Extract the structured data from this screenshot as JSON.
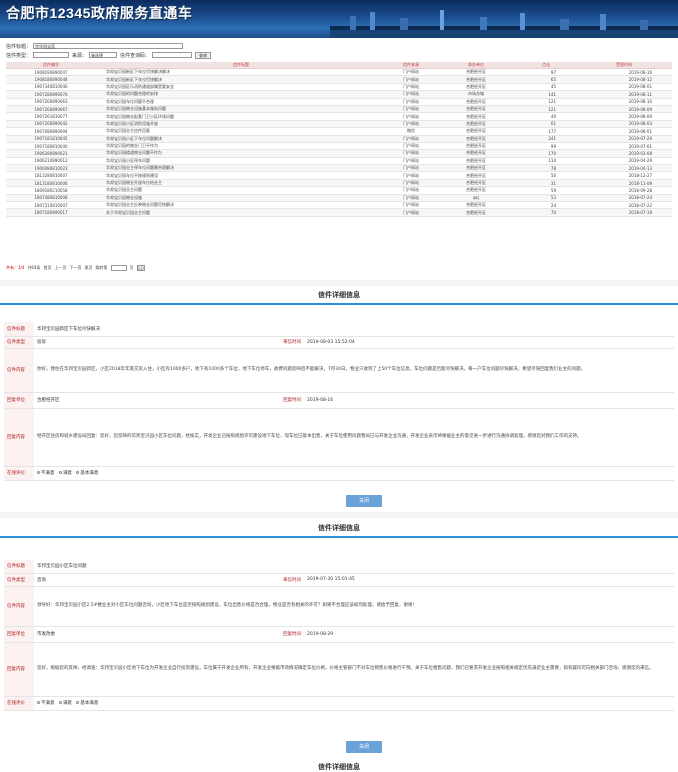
{
  "header": {
    "title": "合肥市12345政府服务直通车"
  },
  "search": {
    "title_label": "信件标题：",
    "title_value": "宗华园宝蓝",
    "type_label": "信件类型：",
    "from_label": "来源：",
    "from_value": "来选择",
    "code_label": "信件查询码：",
    "search_btn": "查询"
  },
  "table": {
    "headers": [
      "信件编号",
      "信件标题",
      "信件来源",
      "承办单位",
      "点击",
      "受理时间"
    ],
    "rows": [
      [
        "1908190890047",
        "华邦宝贝园新区下车位尽快解决解决",
        "门户网站",
        "合肥经开区",
        "97",
        "2019-08-16"
      ],
      [
        "1908180890048",
        "华邦宝贝园新区下车位尽快解决",
        "门户网站",
        "合肥经开区",
        "65",
        "2019-08-12"
      ],
      [
        "1907340810040",
        "华邦宝贝园区乐消防通道部属是要安全",
        "门户网站",
        "合肥经开区",
        "45",
        "2019-08-01"
      ],
      [
        "1907280890076",
        "华邦宝贝园的问题合理的安排",
        "门户网站",
        "市场东城",
        "141",
        "2019-08-11"
      ],
      [
        "1907260890063",
        "华邦宝贝园车位问题不合理",
        "门户网站",
        "合肥经开区",
        "121",
        "2019-08-10"
      ],
      [
        "1907260890067",
        "华邦宝贝园物业设施基本服务问题",
        "门户网站",
        "合肥经开区",
        "121",
        "2019-08-09"
      ],
      [
        "1907261810077",
        "华邦宝贝园物业配套门卫小区环境问题",
        "门户网站",
        "合肥经开区",
        "40",
        "2019-08-09"
      ],
      [
        "1907260890042",
        "华邦宝贝园小区消防设施开放",
        "门户网站",
        "合肥经开区",
        "61",
        "2019-08-03"
      ],
      [
        "1907080890094",
        "华邦宝贝园业主信件回复",
        "微信",
        "合肥经开区",
        "177",
        "2019-08-01"
      ],
      [
        "1907181810045",
        "华邦宝贝园小区下车位问题解决",
        "门户网站",
        "合肥经开区",
        "241",
        "2019-07-29"
      ],
      [
        "1907180810040",
        "华邦宝贝园的物业门卫不作为",
        "门户网站",
        "合肥经开区",
        "99",
        "2019-07-01"
      ],
      [
        "1906280890021",
        "华邦宝贝园楼道物业问题不作为",
        "门户网站",
        "合肥经开区",
        "170",
        "2019-03-08"
      ],
      [
        "1906210890012",
        "华邦宝贝园小区停车问题",
        "门户网站",
        "合肥经开区",
        "114",
        "2019-04-29"
      ],
      [
        "1906080810023",
        "华邦宝贝园业主停车位问题需合理解决",
        "门户网站",
        "合肥经开区",
        "78",
        "2019-04-13"
      ],
      [
        "1813280810007",
        "华邦宝贝园车位不按规则建设",
        "门户网站",
        "合肥经开区",
        "50",
        "2018-12-27"
      ],
      [
        "1813180810006",
        "华邦宝贝园物业开放车位给业主",
        "门户网站",
        "合肥经开区",
        "31",
        "2018-11-09"
      ],
      [
        "1809180210058",
        "华邦宝贝园业主问题",
        "门户网站",
        "合肥经开区",
        "59",
        "2018-09-28"
      ],
      [
        "1807480810008",
        "华邦宝贝园物业设施",
        "门户网站",
        "qkj",
        "53",
        "2018-07-24"
      ],
      [
        "1807310810007",
        "华邦宝贝园业主反映物业问题尽快解决",
        "门户网站",
        "合肥经开区",
        "24",
        "2018-07-22"
      ],
      [
        "1807180890017",
        "关于华邦宝贝园业主问题",
        "门户网站",
        "合肥经开区",
        "70",
        "2018-07-19"
      ]
    ]
  },
  "pager": {
    "text": "共有：1/4",
    "total": "共64条",
    "first": "首页",
    "prev": "上一页",
    "next": "下一页",
    "last": "尾页",
    "jump": "跳转第",
    "page": "页",
    "go": "GO"
  },
  "detail1": {
    "section_title": "信件详细信息",
    "subject_k": "信件标题",
    "subject_v": "华邦宝贝园新区下车位尽快解决",
    "type_k": "信件类型",
    "type_v": "投诉",
    "time_k": "来信时间",
    "time_v": "2019-08-03 15:52:04",
    "content_k": "信件内容",
    "content_v": "你好，我住在华邦宝贝园新区，小区2018年年底交房入住，小区有1000多户，地下有1000多个车位，地下车位停车，收费问题反映后不能解决，7月30日，物业只收到了上50个车位信息。车位问题是否能尽快解决，每一户车位问题尽快解决，希望尽快回复我们业主的问题。",
    "unit_k": "回复单位",
    "unit_v": "合肥经开区",
    "rtime_k": "回复时间",
    "rtime_v": "2019-08-16",
    "reply_k": "回复内容",
    "reply_v": "经开区住房和城乡建设局回复：您好，您反映的华邦宝贝园小区车位问题，经核实，开发企业已按照规划许可建设地下车位，现车位已基本出售，关于车位使用问题我局已与开发企业沟通，开发企业表示将根据业主的意见进一步进行沟通协调处理，感谢您对我们工作的支持。",
    "eval_k": "在线评价",
    "eval_opts": [
      "不满意",
      "满意",
      "基本满意"
    ],
    "close_btn": "关闭"
  },
  "detail2": {
    "section_title": "信件详细信息",
    "subject_k": "信件标题",
    "subject_v": "华邦宝贝园小区车位问题",
    "type_k": "信件类型",
    "type_v": "咨询",
    "time_k": "来信时间",
    "time_v": "2019-07-30 15:01:45",
    "content_k": "信件内容",
    "content_v": "领导好：华邦宝贝园小区2.5#楼业主对小区车位问题咨询，小区地下车位是否按照规划建设，车位出售价格是否合理，物业是否有相关的许可？如果不合理应该如何处理，请给予回复，谢谢！",
    "unit_k": "回复单位",
    "unit_v": "市发改委",
    "rtime_k": "回复时间",
    "rtime_v": "2019-08-29",
    "reply_k": "回复内容",
    "reply_v": "您好，根据您的反映，经调查：华邦宝贝园小区地下车位为开发企业自行投资建设，车位属于开发企业所有，开发企业根据市场情况确定车位价格，价格主管部门不对车位销售价格进行干预。关于车位租售问题，我们已要求开发企业按照相关规定优先满足业主需要，如有疑问可向相关部门咨询，感谢您的来信。",
    "eval_k": "在线评价",
    "eval_opts": [
      "不满意",
      "满意",
      "基本满意"
    ],
    "close_btn": "关闭"
  },
  "detail3": {
    "section_title": "信件详细信息"
  }
}
